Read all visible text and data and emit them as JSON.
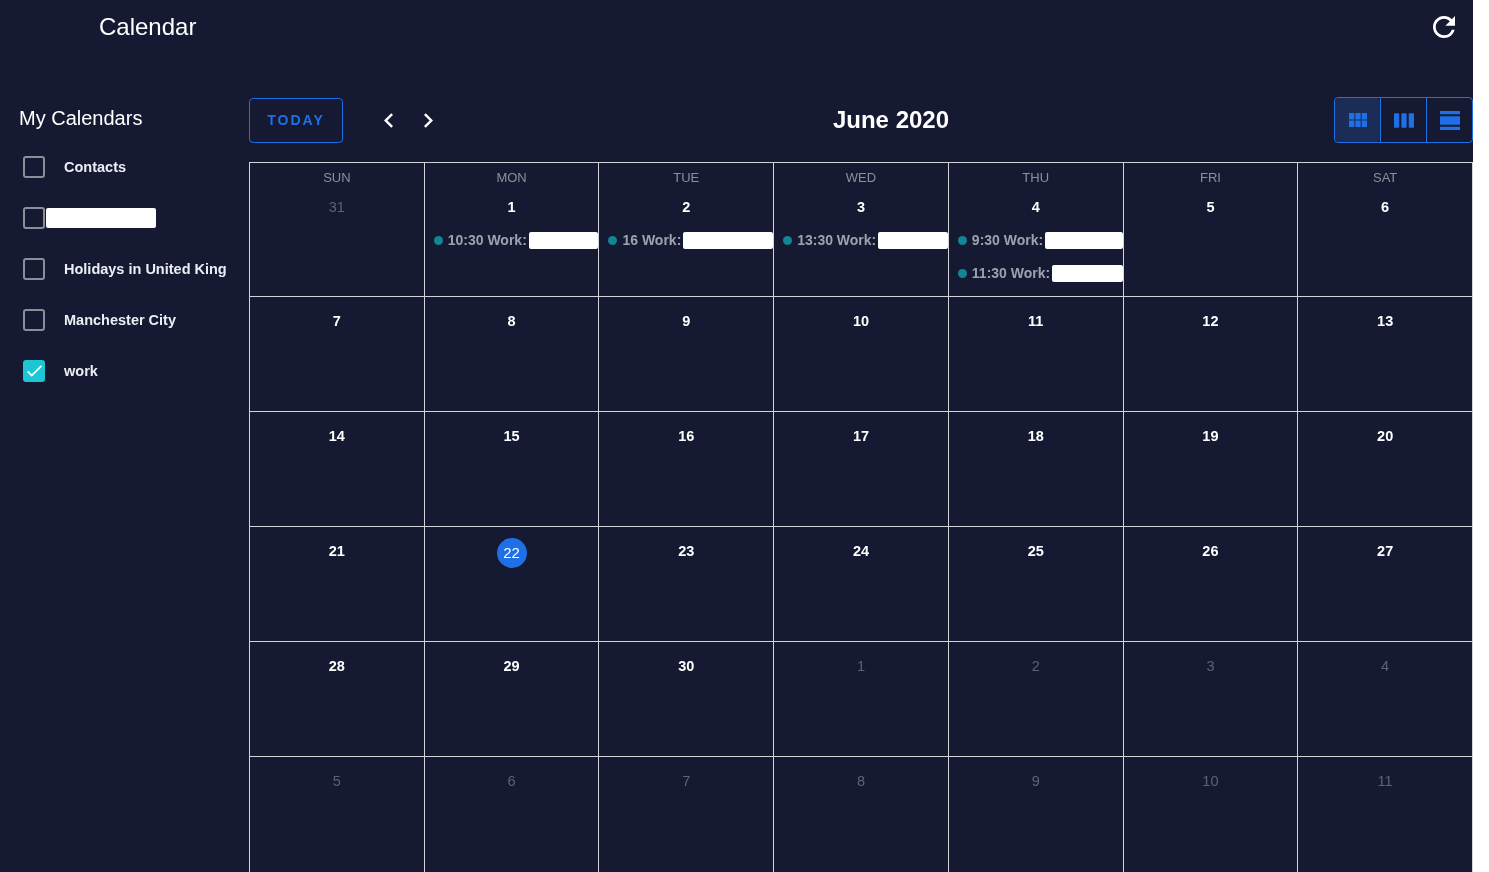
{
  "app_bar": {
    "title": "Calendar"
  },
  "sidebar": {
    "heading": "My Calendars",
    "calendars": [
      {
        "label": "Contacts",
        "checked": false,
        "redacted": false
      },
      {
        "checked": false,
        "redacted": true
      },
      {
        "label": "Holidays in United King",
        "checked": false,
        "redacted": false
      },
      {
        "label": "Manchester City",
        "checked": false,
        "redacted": false
      },
      {
        "label": "work",
        "checked": true,
        "redacted": false
      }
    ]
  },
  "toolbar": {
    "today": "TODAY",
    "title": "June 2020",
    "views": [
      {
        "kind": "grid",
        "selected": true
      },
      {
        "kind": "columns",
        "selected": false
      },
      {
        "kind": "rows",
        "selected": false
      }
    ]
  },
  "month": {
    "weekdays": [
      "SUN",
      "MON",
      "TUE",
      "WED",
      "THU",
      "FRI",
      "SAT"
    ],
    "weeks": [
      [
        {
          "date": "31",
          "outside": true,
          "today": false
        },
        {
          "date": "1",
          "outside": false,
          "today": false,
          "events": [
            {
              "text": "10:30 Work:",
              "redacted": true
            }
          ]
        },
        {
          "date": "2",
          "outside": false,
          "today": false,
          "events": [
            {
              "text": "16 Work:",
              "redacted": true
            }
          ]
        },
        {
          "date": "3",
          "outside": false,
          "today": false,
          "events": [
            {
              "text": "13:30 Work:",
              "redacted": true
            }
          ]
        },
        {
          "date": "4",
          "outside": false,
          "today": false,
          "events": [
            {
              "text": "9:30 Work:",
              "redacted": true
            },
            {
              "text": "11:30 Work:",
              "redacted": true
            }
          ]
        },
        {
          "date": "5",
          "outside": false,
          "today": false
        },
        {
          "date": "6",
          "outside": false,
          "today": false
        }
      ],
      [
        {
          "date": "7",
          "outside": false,
          "today": false
        },
        {
          "date": "8",
          "outside": false,
          "today": false
        },
        {
          "date": "9",
          "outside": false,
          "today": false
        },
        {
          "date": "10",
          "outside": false,
          "today": false
        },
        {
          "date": "11",
          "outside": false,
          "today": false
        },
        {
          "date": "12",
          "outside": false,
          "today": false
        },
        {
          "date": "13",
          "outside": false,
          "today": false
        }
      ],
      [
        {
          "date": "14",
          "outside": false,
          "today": false
        },
        {
          "date": "15",
          "outside": false,
          "today": false
        },
        {
          "date": "16",
          "outside": false,
          "today": false
        },
        {
          "date": "17",
          "outside": false,
          "today": false
        },
        {
          "date": "18",
          "outside": false,
          "today": false
        },
        {
          "date": "19",
          "outside": false,
          "today": false
        },
        {
          "date": "20",
          "outside": false,
          "today": false
        }
      ],
      [
        {
          "date": "21",
          "outside": false,
          "today": false
        },
        {
          "date": "22",
          "outside": false,
          "today": true
        },
        {
          "date": "23",
          "outside": false,
          "today": false
        },
        {
          "date": "24",
          "outside": false,
          "today": false
        },
        {
          "date": "25",
          "outside": false,
          "today": false
        },
        {
          "date": "26",
          "outside": false,
          "today": false
        },
        {
          "date": "27",
          "outside": false,
          "today": false
        }
      ],
      [
        {
          "date": "28",
          "outside": false,
          "today": false
        },
        {
          "date": "29",
          "outside": false,
          "today": false
        },
        {
          "date": "30",
          "outside": false,
          "today": false
        },
        {
          "date": "1",
          "outside": true,
          "today": false
        },
        {
          "date": "2",
          "outside": true,
          "today": false
        },
        {
          "date": "3",
          "outside": true,
          "today": false
        },
        {
          "date": "4",
          "outside": true,
          "today": false
        }
      ],
      [
        {
          "date": "5",
          "outside": true,
          "today": false
        },
        {
          "date": "6",
          "outside": true,
          "today": false
        },
        {
          "date": "7",
          "outside": true,
          "today": false
        },
        {
          "date": "8",
          "outside": true,
          "today": false
        },
        {
          "date": "9",
          "outside": true,
          "today": false
        },
        {
          "date": "10",
          "outside": true,
          "today": false
        },
        {
          "date": "11",
          "outside": true,
          "today": false
        }
      ]
    ]
  }
}
